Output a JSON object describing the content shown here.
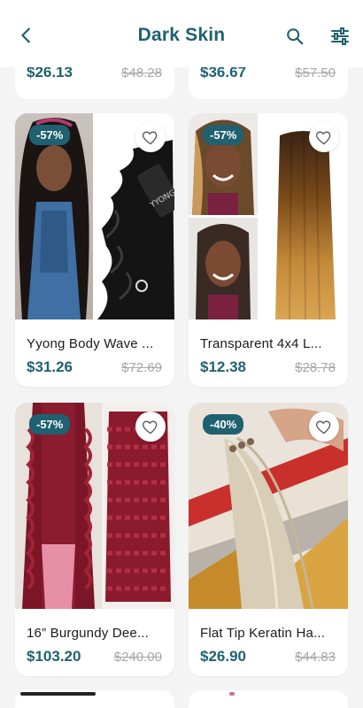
{
  "header": {
    "title": "Dark Skin",
    "back_icon": "chevron-left-icon",
    "search_icon": "search-icon",
    "filter_icon": "sliders-icon"
  },
  "colors": {
    "accent": "#1f6170",
    "price": "#1f6170",
    "old_price": "#a7a7a7",
    "background": "#f4f4f4"
  },
  "partial_top": [
    {
      "price": "$26.13",
      "old_price": "$48.28"
    },
    {
      "price": "$36.67",
      "old_price": "$57.50"
    }
  ],
  "products": [
    {
      "discount": "-57%",
      "name": "Yyong Body Wave ...",
      "price": "$31.26",
      "old_price": "$72.69"
    },
    {
      "discount": "-57%",
      "name": "Transparent 4x4 L...",
      "price": "$12.38",
      "old_price": "$28.78"
    },
    {
      "discount": "-57%",
      "name": "16” Burgundy Dee...",
      "price": "$103.20",
      "old_price": "$240.00"
    },
    {
      "discount": "-40%",
      "name": "Flat Tip Keratin Ha...",
      "price": "$26.90",
      "old_price": "$44.83"
    }
  ]
}
